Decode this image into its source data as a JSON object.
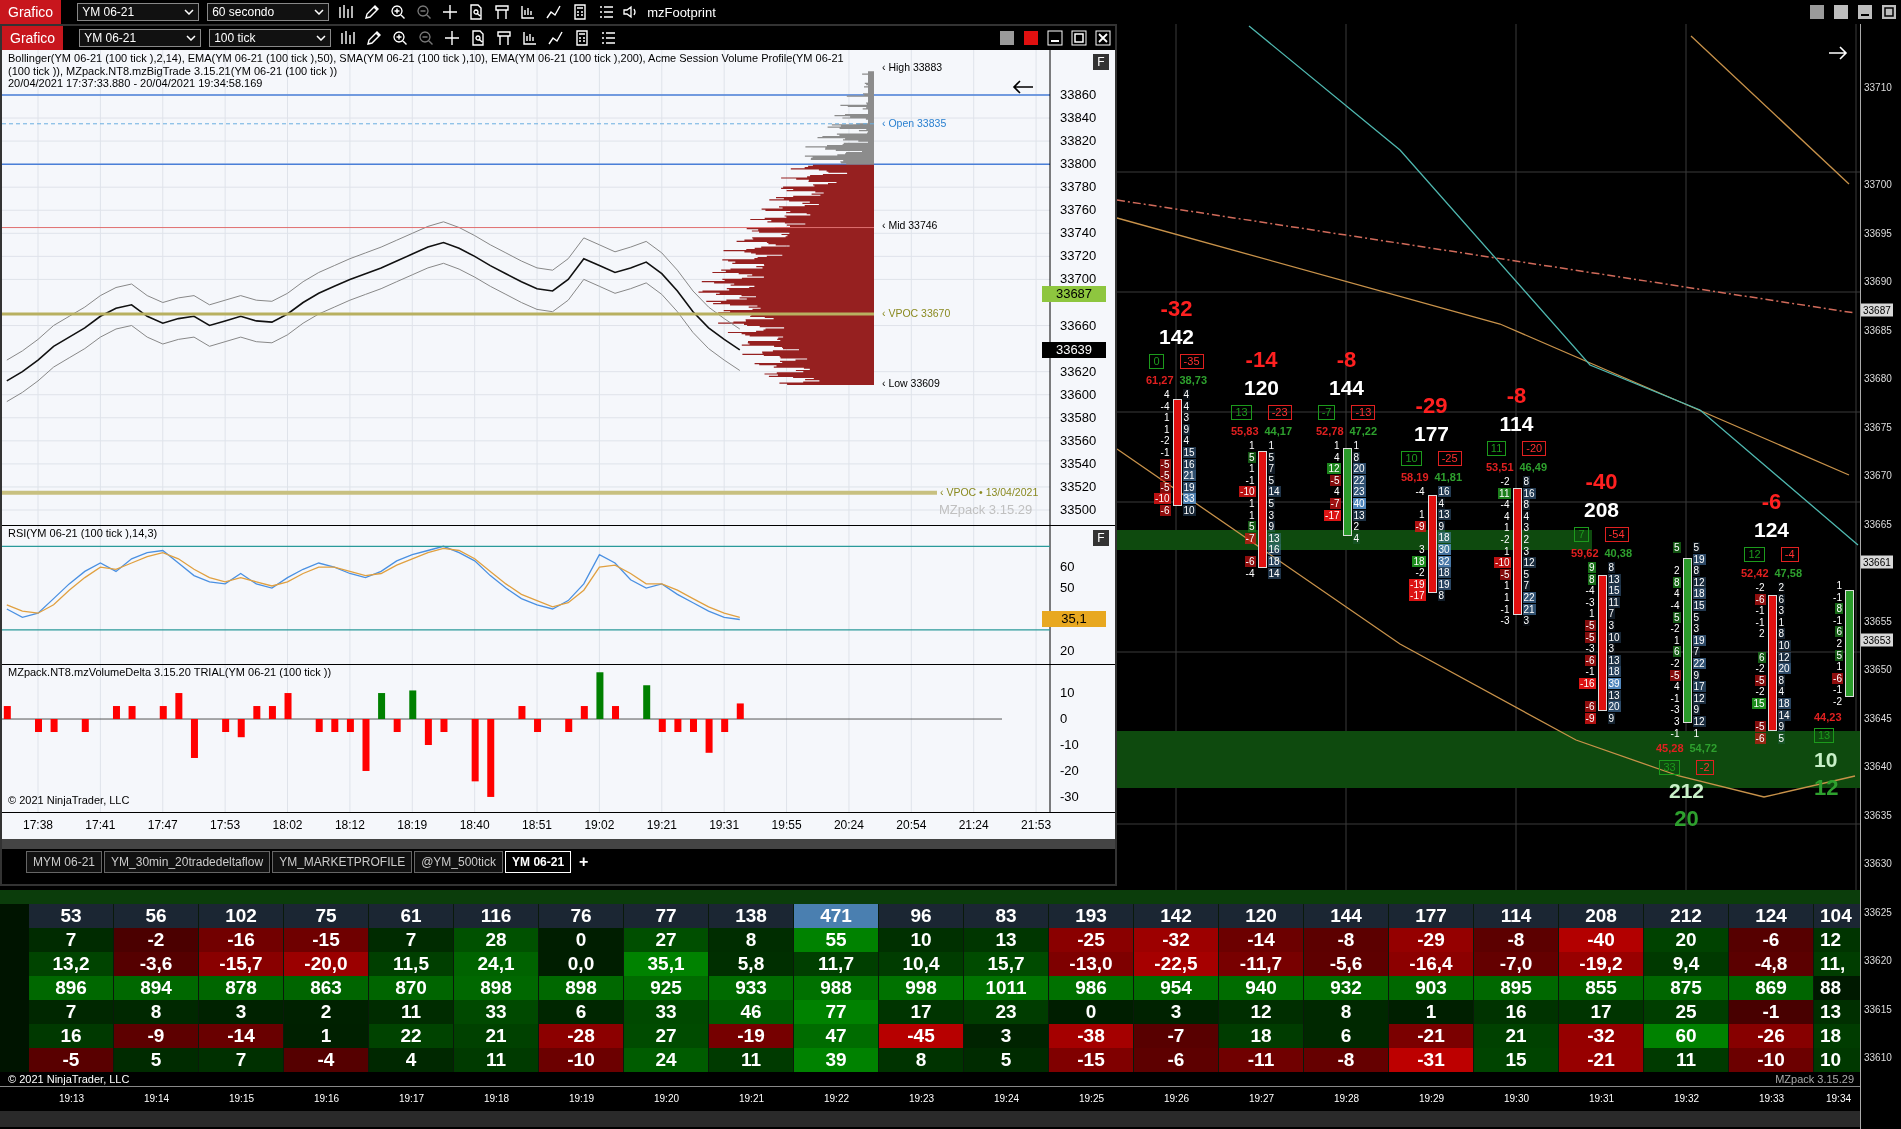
{
  "topbar": {
    "chart_button": "Grafico",
    "instrument": "YM 06-21",
    "interval": "60 secondo",
    "zoom_out_enabled": false,
    "indicator": "mzFootprint"
  },
  "window": {
    "chart_button": "Grafico",
    "instrument": "YM 06-21",
    "interval": "100 tick",
    "zoom_out_enabled": false,
    "price_panel": {
      "legend": "Bollinger(YM 06-21 (100 tick ),2,14), EMA(YM 06-21 (100 tick ),50), SMA(YM 06-21 (100 tick ),10), EMA(YM 06-21 (100 tick ),200), Acme Session Volume Profile(YM 06-21 (100 tick )), MZpack.NT8.mzBigTrade 3.15.21(YM 06-21 (100 tick ))",
      "range": "20/04/2021 17:37:33.880 - 20/04/2021 19:34:58.169",
      "f_button": "F",
      "profile_labels": [
        {
          "kind": "high",
          "label": "‹ High 33883"
        },
        {
          "kind": "open",
          "label": "‹ Open 33835"
        },
        {
          "kind": "mid",
          "label": "‹ Mid 33746"
        },
        {
          "kind": "vpoc",
          "label": "‹ VPOC 33670"
        },
        {
          "kind": "low",
          "label": "‹ Low 33609"
        },
        {
          "kind": "prior_vpoc",
          "label": "‹ VPOC • 13/04/2021"
        }
      ],
      "watermark": "MZpack 3.15.29",
      "price_tags": [
        {
          "kind": "last",
          "label": "33687"
        },
        {
          "kind": "current",
          "label": "33639"
        }
      ],
      "chart_data": {
        "type": "line",
        "grid": true,
        "series": [
          {
            "color": "#111111",
            "values": [
              33612,
              33620,
              33630,
              33642,
              33650,
              33658,
              33668,
              33675,
              33678,
              33668,
              33662,
              33666,
              33668,
              33660,
              33664,
              33668,
              33664,
              33663,
              33670,
              33680,
              33688,
              33694,
              33700,
              33705,
              33710,
              33716,
              33722,
              33728,
              33732,
              33727,
              33720,
              33712,
              33705,
              33698,
              33692,
              33690,
              33700,
              33718,
              33712,
              33706,
              33710,
              33715,
              33705,
              33690,
              33672,
              33658,
              33648,
              33639,
              null,
              null,
              null,
              null,
              null,
              null,
              null,
              null,
              null,
              null,
              null,
              null,
              null,
              null,
              null,
              null,
              null,
              null,
              null,
              null
            ]
          },
          {
            "color": "#888888",
            "values": [
              33630,
              33638,
              33648,
              33660,
              33668,
              33676,
              33686,
              33693,
              33696,
              33686,
              33680,
              33684,
              33686,
              33678,
              33682,
              33686,
              33682,
              33681,
              33688,
              33698,
              33706,
              33712,
              33718,
              33723,
              33728,
              33734,
              33740,
              33746,
              33750,
              33745,
              33738,
              33730,
              33723,
              33716,
              33710,
              33708,
              33718,
              33736,
              33730,
              33724,
              33728,
              33733,
              33723,
              33708,
              33690,
              33676,
              33666,
              33657,
              null,
              null,
              null,
              null,
              null,
              null,
              null,
              null,
              null,
              null,
              null,
              null,
              null,
              null,
              null,
              null,
              null,
              null,
              null,
              null
            ]
          },
          {
            "color": "#888888",
            "values": [
              33594,
              33602,
              33612,
              33624,
              33632,
              33640,
              33650,
              33657,
              33660,
              33650,
              33644,
              33648,
              33650,
              33642,
              33646,
              33650,
              33646,
              33645,
              33652,
              33662,
              33670,
              33676,
              33682,
              33687,
              33692,
              33698,
              33704,
              33710,
              33714,
              33709,
              33702,
              33694,
              33687,
              33680,
              33674,
              33672,
              33682,
              33700,
              33694,
              33688,
              33692,
              33697,
              33687,
              33672,
              33654,
              33640,
              33630,
              33621,
              null,
              null,
              null,
              null,
              null,
              null,
              null,
              null,
              null,
              null,
              null,
              null,
              null,
              null,
              null,
              null,
              null,
              null,
              null,
              null
            ]
          }
        ],
        "ylim": [
          33487,
          33899
        ],
        "yticks": [
          {
            "value": 33860,
            "label": "33860"
          },
          {
            "value": 33840,
            "label": "33840"
          },
          {
            "value": 33820,
            "label": "33820"
          },
          {
            "value": 33800,
            "label": "33800"
          },
          {
            "value": 33780,
            "label": "33780"
          },
          {
            "value": 33760,
            "label": "33760"
          },
          {
            "value": 33740,
            "label": "33740"
          },
          {
            "value": 33720,
            "label": "33720"
          },
          {
            "value": 33700,
            "label": "33700"
          },
          {
            "value": 33660,
            "label": "33660"
          },
          {
            "value": 33620,
            "label": "33620"
          },
          {
            "value": 33600,
            "label": "33600"
          },
          {
            "value": 33580,
            "label": "33580"
          },
          {
            "value": 33560,
            "label": "33560"
          },
          {
            "value": 33540,
            "label": "33540"
          },
          {
            "value": 33520,
            "label": "33520"
          },
          {
            "value": 33500,
            "label": "33500"
          }
        ]
      }
    },
    "rsi_panel": {
      "title": "RSI(YM 06-21 (100 tick ),14,3)",
      "f_button": "F",
      "tag": "35,1",
      "chart_data": {
        "type": "line",
        "grid": true,
        "series": [
          {
            "color": "#4a90e2",
            "values": [
              40,
              36,
              38,
              45,
              52,
              58,
              62,
              58,
              64,
              67,
              68,
              62,
              56,
              53,
              52,
              57,
              52,
              50,
              55,
              59,
              62,
              60,
              57,
              55,
              58,
              63,
              66,
              68,
              70,
              67,
              63,
              56,
              50,
              45,
              42,
              40,
              44,
              52,
              66,
              62,
              54,
              50,
              52,
              47,
              43,
              39,
              36,
              35,
              null,
              null,
              null,
              null,
              null,
              null,
              null,
              null,
              null,
              null,
              null,
              null,
              null,
              null,
              null,
              null,
              null,
              null,
              null,
              null
            ]
          },
          {
            "color": "#e0a040",
            "values": [
              42,
              39,
              38,
              42,
              49,
              55,
              60,
              59,
              62,
              65,
              67,
              64,
              59,
              55,
              53,
              55,
              53,
              51,
              53,
              57,
              60,
              60,
              58,
              56,
              57,
              61,
              64,
              67,
              69,
              68,
              64,
              58,
              52,
              47,
              44,
              41,
              43,
              49,
              60,
              61,
              57,
              52,
              52,
              49,
              45,
              41,
              38,
              36,
              null,
              null,
              null,
              null,
              null,
              null,
              null,
              null,
              null,
              null,
              null,
              null,
              null,
              null,
              null,
              null,
              null,
              null,
              null,
              null
            ]
          }
        ],
        "ylim": [
          13.7,
          79.7
        ],
        "yticks": [
          60,
          50,
          20
        ]
      }
    },
    "delta_panel": {
      "title": "MZpack.NT8.mzVolumeDelta 3.15.20 TRIAL(YM 06-21 (100 tick ))",
      "copyright": "© 2021 NinjaTrader, LLC",
      "chart_data": {
        "type": "bar",
        "grid": true,
        "categories": [
          null,
          null,
          "17:38",
          null,
          null,
          null,
          "17:41",
          null,
          null,
          null,
          "17:47",
          null,
          null,
          null,
          "17:53",
          null,
          null,
          null,
          "18:02",
          null,
          null,
          null,
          "18:12",
          null,
          null,
          null,
          "18:19",
          null,
          null,
          null,
          "18:40",
          null,
          null,
          null,
          "18:51",
          null,
          null,
          null,
          "19:02",
          null,
          null,
          null,
          "19:21",
          null,
          null,
          null,
          "19:31",
          null,
          null,
          null,
          "19:55",
          null,
          null,
          null,
          "20:24",
          null,
          null,
          null,
          "20:54",
          null,
          null,
          null,
          "21:24",
          null,
          null,
          null,
          "21:53",
          null
        ],
        "series": [
          {
            "color": "#ff0000",
            "values": [
              5,
              null,
              -5,
              -5,
              null,
              -5,
              null,
              5,
              5,
              null,
              5,
              10,
              -15,
              null,
              -5,
              -7,
              5,
              5,
              10,
              null,
              -5,
              -5,
              -5,
              -20,
              null,
              -5,
              null,
              -10,
              -5,
              null,
              -24,
              -30,
              null,
              5,
              -5,
              null,
              -5,
              5,
              null,
              5,
              null,
              null,
              -5,
              -5,
              -5,
              -13,
              -5,
              6,
              null,
              null,
              null,
              null,
              null,
              null,
              null,
              null,
              null,
              null,
              null,
              null,
              null,
              null,
              null,
              null,
              null,
              null,
              null,
              null
            ]
          },
          {
            "color": "#008000",
            "values": [
              null,
              null,
              null,
              null,
              null,
              null,
              null,
              null,
              null,
              null,
              null,
              null,
              null,
              null,
              null,
              null,
              null,
              null,
              null,
              null,
              null,
              null,
              null,
              null,
              10,
              null,
              11,
              null,
              null,
              null,
              null,
              null,
              null,
              null,
              null,
              null,
              null,
              null,
              18,
              null,
              null,
              13,
              null,
              null,
              null,
              null,
              null,
              null,
              null,
              null,
              null,
              null,
              null,
              null,
              null,
              null,
              null,
              null,
              null,
              null,
              null,
              null,
              null,
              null,
              null,
              null,
              null,
              null
            ]
          }
        ],
        "ylim": [
          -35.8,
          20.8
        ],
        "yticks": [
          10,
          0,
          -10,
          -20,
          -30
        ]
      }
    },
    "tabs": [
      {
        "label": "MYM 06-21",
        "selected": false
      },
      {
        "label": "YM_30min_20tradedeltaflow",
        "selected": false
      },
      {
        "label": "YM_MARKETPROFILE",
        "selected": false
      },
      {
        "label": "@YM_500tick",
        "selected": false
      },
      {
        "label": "YM 06-21",
        "selected": true
      }
    ],
    "add_tab": "+"
  },
  "footprint": {
    "columns": [
      {
        "kind": "top",
        "delta": "-32",
        "volume": "142",
        "box_buy": "0",
        "box_sell": "-35",
        "pct_sell": "61,27",
        "pct_buy": "38,73",
        "bullish": false,
        "ladder": [
          {
            "bid": "4",
            "ask": "4"
          },
          {
            "bid": "-4",
            "ask": "4"
          },
          {
            "bid": "1",
            "ask": "3"
          },
          {
            "bid": "1",
            "ask": "9"
          },
          {
            "bid": "-2",
            "ask": "4"
          },
          {
            "bid": "-1",
            "ask": "15"
          },
          {
            "bid": "-5",
            "ask": "16"
          },
          {
            "bid": "-5",
            "ask": "21"
          },
          {
            "bid": "-5",
            "ask": "19"
          },
          {
            "bid": "-10",
            "ask": "33"
          },
          {
            "bid": "-6",
            "ask": "10"
          }
        ]
      },
      {
        "kind": "top",
        "delta": "-14",
        "volume": "120",
        "box_buy": "13",
        "box_sell": "-23",
        "pct_sell": "55,83",
        "pct_buy": "44,17",
        "bullish": false,
        "ladder": [
          {
            "bid": "1",
            "ask": "1"
          },
          {
            "bid": "5",
            "ask": "5"
          },
          {
            "bid": "1",
            "ask": "7"
          },
          {
            "bid": "-1",
            "ask": "5"
          },
          {
            "bid": "-10",
            "ask": "14"
          },
          {
            "bid": "1",
            "ask": "5"
          },
          {
            "bid": "1",
            "ask": "3"
          },
          {
            "bid": "5",
            "ask": "9"
          },
          {
            "bid": "-7",
            "ask": "13"
          },
          {
            "ask": "16"
          },
          {
            "bid": "-6",
            "ask": "18"
          },
          {
            "bid": "-4",
            "ask": "14"
          }
        ]
      },
      {
        "kind": "top",
        "delta": "-8",
        "volume": "144",
        "box_buy": "-7",
        "box_sell": "-13",
        "pct_sell": "52,78",
        "pct_buy": "47,22",
        "bullish": true,
        "ladder": [
          {
            "bid": "1",
            "ask": "1"
          },
          {
            "bid": "4",
            "ask": "8"
          },
          {
            "bid": "12",
            "ask": "20"
          },
          {
            "bid": "-5",
            "ask": "22"
          },
          {
            "bid": "4",
            "ask": "23"
          },
          {
            "bid": "-7",
            "ask": "40"
          },
          {
            "bid": "-17",
            "ask": "13"
          },
          {
            "ask": "2"
          },
          {
            "ask": "4"
          }
        ]
      },
      {
        "kind": "top",
        "delta": "-29",
        "volume": "177",
        "box_buy": "10",
        "box_sell": "-25",
        "pct_sell": "58,19",
        "pct_buy": "41,81",
        "bullish": false,
        "ladder": [
          {
            "bid": "-4",
            "ask": "16"
          },
          {
            "ask": "4"
          },
          {
            "bid": "1",
            "ask": "13"
          },
          {
            "bid": "-9",
            "ask": "9"
          },
          {
            "ask": "18"
          },
          {
            "bid": "3",
            "ask": "30"
          },
          {
            "bid": "18",
            "ask": "32"
          },
          {
            "bid": "-2",
            "ask": "18"
          },
          {
            "bid": "-19",
            "ask": "19"
          },
          {
            "bid": "-17",
            "ask": "8"
          }
        ]
      },
      {
        "kind": "top",
        "delta": "-8",
        "volume": "114",
        "box_buy": "11",
        "box_sell": "-20",
        "pct_sell": "53,51",
        "pct_buy": "46,49",
        "bullish": false,
        "ladder": [
          {
            "bid": "-2",
            "ask": "8"
          },
          {
            "bid": "11",
            "ask": "16"
          },
          {
            "bid": "-4",
            "ask": "8"
          },
          {
            "bid": "4",
            "ask": "4"
          },
          {
            "bid": "1",
            "ask": "3"
          },
          {
            "bid": "-2",
            "ask": "2"
          },
          {
            "bid": "1",
            "ask": "3"
          },
          {
            "bid": "-10",
            "ask": "12"
          },
          {
            "bid": "-5",
            "ask": "5"
          },
          {
            "bid": "1",
            "ask": "7"
          },
          {
            "bid": "1",
            "ask": "22"
          },
          {
            "bid": "-1",
            "ask": "21"
          },
          {
            "bid": "-3",
            "ask": "3"
          }
        ]
      },
      {
        "kind": "top",
        "delta": "-40",
        "volume": "208",
        "box_buy": "7",
        "box_sell": "-54",
        "pct_sell": "59,62",
        "pct_buy": "40,38",
        "bullish": false,
        "ladder": [
          {
            "bid": "9",
            "ask": "8"
          },
          {
            "bid": "8",
            "ask": "13"
          },
          {
            "bid": "-4",
            "ask": "15"
          },
          {
            "bid": "-3",
            "ask": "11"
          },
          {
            "bid": "1",
            "ask": "7"
          },
          {
            "bid": "-5",
            "ask": "3"
          },
          {
            "bid": "-5",
            "ask": "10"
          },
          {
            "bid": "-3",
            "ask": "3"
          },
          {
            "bid": "-6",
            "ask": "13"
          },
          {
            "bid": "-1",
            "ask": "18"
          },
          {
            "bid": "-16",
            "ask": "39"
          },
          {
            "ask": "13"
          },
          {
            "bid": "-6",
            "ask": "20"
          },
          {
            "bid": "-9",
            "ask": "9"
          }
        ]
      },
      {
        "kind": "bottom",
        "delta": "20",
        "volume": "212",
        "box_buy": "33",
        "box_sell": "-2",
        "pct_sell": "45,28",
        "pct_buy": "54,72",
        "bullish": true,
        "ladder": [
          {
            "bid": "5",
            "ask": "5"
          },
          {
            "ask": "19"
          },
          {
            "bid": "2",
            "ask": "8"
          },
          {
            "bid": "8",
            "ask": "12"
          },
          {
            "bid": "4",
            "ask": "18"
          },
          {
            "bid": "-4",
            "ask": "15"
          },
          {
            "bid": "5",
            "ask": "5"
          },
          {
            "bid": "-2",
            "ask": "3"
          },
          {
            "bid": "1",
            "ask": "19"
          },
          {
            "bid": "6",
            "ask": "7"
          },
          {
            "bid": "-2",
            "ask": "22"
          },
          {
            "bid": "-5",
            "ask": "9"
          },
          {
            "bid": "4",
            "ask": "17"
          },
          {
            "bid": "-1",
            "ask": "12"
          },
          {
            "bid": "-3",
            "ask": "9"
          },
          {
            "bid": "3",
            "ask": "12"
          },
          {
            "bid": "-1",
            "ask": "1"
          }
        ]
      },
      {
        "kind": "top",
        "delta": "-6",
        "volume": "124",
        "box_buy": "12",
        "box_sell": "-4",
        "pct_sell": "52,42",
        "pct_buy": "47,58",
        "bullish": false,
        "ladder": [
          {
            "bid": "-2",
            "ask": "2"
          },
          {
            "bid": "-6",
            "ask": "6"
          },
          {
            "bid": "-1",
            "ask": "3"
          },
          {
            "bid": "-1",
            "ask": "1"
          },
          {
            "bid": "2",
            "ask": "8"
          },
          {
            "ask": "10"
          },
          {
            "bid": "6",
            "ask": "12"
          },
          {
            "bid": "-2",
            "ask": "20"
          },
          {
            "bid": "-5",
            "ask": "8"
          },
          {
            "bid": "-2",
            "ask": "4"
          },
          {
            "bid": "15",
            "ask": "18"
          },
          {
            "ask": "14"
          },
          {
            "bid": "-5",
            "ask": "9"
          },
          {
            "bid": "-6",
            "ask": "5"
          }
        ]
      },
      {
        "kind": "bottom",
        "delta": "12",
        "volume": "10",
        "box_buy": "13",
        "pct_sell": "44,23",
        "bullish": true,
        "ladder": [
          {
            "bid": "1"
          },
          {
            "bid": "-1"
          },
          {
            "bid": "8"
          },
          {
            "bid": "-1"
          },
          {
            "bid": "6"
          },
          {
            "bid": "2"
          },
          {
            "bid": "5"
          },
          {
            "bid": "1"
          },
          {
            "bid": "-6"
          },
          {
            "bid": "-1"
          },
          {
            "bid": "-2"
          }
        ]
      }
    ],
    "price_axis": [
      {
        "kind": "tick",
        "label": "33710"
      },
      {
        "kind": "tick",
        "label": "33700"
      },
      {
        "kind": "tick",
        "label": "33695"
      },
      {
        "kind": "tick",
        "label": "33690"
      },
      {
        "kind": "tag",
        "label": "33687"
      },
      {
        "kind": "tick",
        "label": "33685"
      },
      {
        "kind": "tick",
        "label": "33680"
      },
      {
        "kind": "tick",
        "label": "33675"
      },
      {
        "kind": "tick",
        "label": "33670"
      },
      {
        "kind": "tick",
        "label": "33665"
      },
      {
        "kind": "tag",
        "label": "33661"
      },
      {
        "kind": "tick",
        "label": "33655"
      },
      {
        "kind": "tag",
        "label": "33653"
      },
      {
        "kind": "tick",
        "label": "33650"
      },
      {
        "kind": "tick",
        "label": "33645"
      },
      {
        "kind": "tick",
        "label": "33640"
      },
      {
        "kind": "tick",
        "label": "33635"
      },
      {
        "kind": "tick",
        "label": "33630"
      },
      {
        "kind": "tick",
        "label": "33625"
      },
      {
        "kind": "tick",
        "label": "33620"
      },
      {
        "kind": "tick",
        "label": "33615"
      },
      {
        "kind": "tick",
        "label": "33610"
      }
    ]
  },
  "table": {
    "rows": [
      {
        "kind": "volume",
        "cells": [
          "53",
          "56",
          "102",
          "75",
          "61",
          "116",
          "76",
          "77",
          "138",
          "471",
          "96",
          "83",
          "193",
          "142",
          "120",
          "144",
          "177",
          "114",
          "208",
          "212",
          "124",
          "104"
        ]
      },
      {
        "kind": "delta",
        "cells": [
          "7",
          "-2",
          "-16",
          "-15",
          "7",
          "28",
          "0",
          "27",
          "8",
          "55",
          "10",
          "13",
          "-25",
          "-32",
          "-14",
          "-8",
          "-29",
          "-8",
          "-40",
          "20",
          "-6",
          "12"
        ]
      },
      {
        "kind": "delta_percent",
        "cells": [
          "13,2",
          "-3,6",
          "-15,7",
          "-20,0",
          "11,5",
          "24,1",
          "0,0",
          "35,1",
          "5,8",
          "11,7",
          "10,4",
          "15,7",
          "-13,0",
          "-22,5",
          "-11,7",
          "-5,6",
          "-16,4",
          "-7,0",
          "-19,2",
          "9,4",
          "-4,8",
          "11,"
        ]
      },
      {
        "kind": "cumulative",
        "cells": [
          "896",
          "894",
          "878",
          "863",
          "870",
          "898",
          "898",
          "925",
          "933",
          "988",
          "998",
          "1011",
          "986",
          "954",
          "940",
          "932",
          "903",
          "895",
          "855",
          "875",
          "869",
          "88"
        ]
      },
      {
        "kind": "signed",
        "cells": [
          "7",
          "8",
          "3",
          "2",
          "11",
          "33",
          "6",
          "33",
          "46",
          "77",
          "17",
          "23",
          "0",
          "3",
          "12",
          "8",
          "1",
          "16",
          "17",
          "25",
          "-1",
          "13"
        ]
      },
      {
        "kind": "signed",
        "cells": [
          "16",
          "-9",
          "-14",
          "1",
          "22",
          "21",
          "-28",
          "27",
          "-19",
          "47",
          "-45",
          "3",
          "-38",
          "-7",
          "18",
          "6",
          "-21",
          "21",
          "-32",
          "60",
          "-26",
          "18"
        ]
      },
      {
        "kind": "signed",
        "cells": [
          "-5",
          "5",
          "7",
          "-4",
          "4",
          "11",
          "-10",
          "24",
          "11",
          "39",
          "8",
          "5",
          "-15",
          "-6",
          "-11",
          "-8",
          "-31",
          "15",
          "-21",
          "11",
          "-10",
          "10"
        ]
      }
    ],
    "copyright": "© 2021 NinjaTrader, LLC",
    "watermark": "MZpack 3.15.29",
    "times": [
      "19:13",
      "19:14",
      "19:15",
      "19:16",
      "19:17",
      "19:18",
      "19:19",
      "19:20",
      "19:21",
      "19:22",
      "19:23",
      "19:24",
      "19:25",
      "19:26",
      "19:27",
      "19:28",
      "19:29",
      "19:30",
      "19:31",
      "19:32",
      "19:33",
      "19:34"
    ]
  }
}
